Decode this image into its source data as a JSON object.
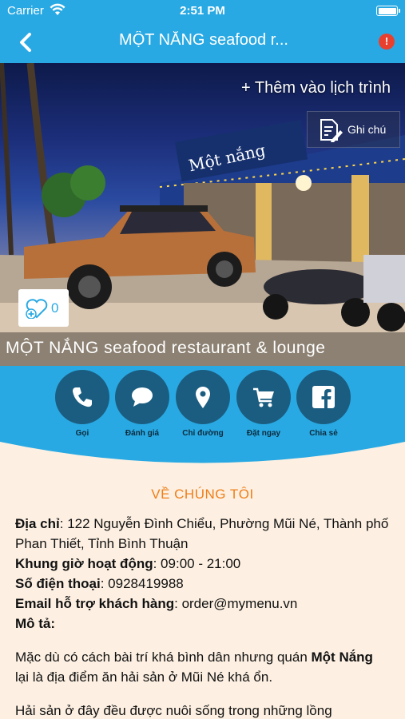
{
  "status": {
    "carrier": "Carrier",
    "time": "2:51 PM"
  },
  "nav": {
    "title": "MỘT NẮNG seafood r...",
    "alert": "!"
  },
  "hero": {
    "add_to_plan": "+ Thêm vào lịch trình",
    "note_label": "Ghi chú",
    "like_count": "0",
    "caption": "MỘT NẮNG seafood restaurant & lounge",
    "sign_text": "Một nắng"
  },
  "actions": [
    {
      "label": "Gọi",
      "icon": "phone-icon"
    },
    {
      "label": "Đánh giá",
      "icon": "chat-bubble-icon"
    },
    {
      "label": "Chỉ đường",
      "icon": "map-pin-icon"
    },
    {
      "label": "Đặt ngay",
      "icon": "cart-icon"
    },
    {
      "label": "Chia sẻ",
      "icon": "facebook-icon"
    }
  ],
  "about": {
    "heading": "VỀ CHÚNG TÔI",
    "address_label": "Địa chỉ",
    "address": ": 122 Nguyễn Đình Chiểu, Phường Mũi Né, Thành phố Phan Thiết, Tỉnh Bình Thuận",
    "hours_label": "Khung giờ hoạt động",
    "hours": ": 09:00 - 21:00",
    "phone_label": "Số điện thoại",
    "phone": ": 0928419988",
    "email_label": "Email hỗ trợ khách hàng",
    "email": ": order@mymenu.vn",
    "desc_label": "Mô tả",
    "desc_colon": ":",
    "para1_a": "Mặc dù có cách bài trí khá bình dân nhưng quán ",
    "para1_b": "Một Nắng",
    "para1_c": " lại là địa điểm ăn hải sản ở Mũi Né khá ổn.",
    "para2": "Hải sản ở đây đều được nuôi sống trong những lồng"
  },
  "colors": {
    "primary": "#29a9e3",
    "dark_button": "#1b5d80",
    "accent": "#ef7e18",
    "background": "#fdf0e2",
    "alert": "#e8402f"
  }
}
